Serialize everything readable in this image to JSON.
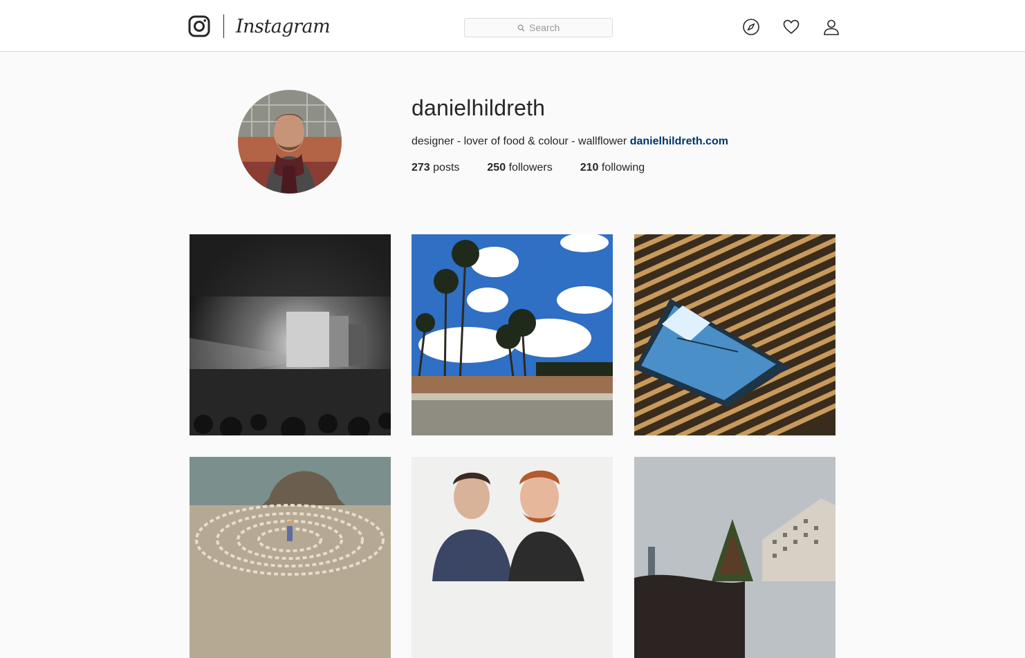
{
  "header": {
    "wordmark": "Instagram",
    "search_placeholder": "Search",
    "icons": [
      "instagram-camera-icon",
      "search-icon",
      "explore-compass-icon",
      "activity-heart-icon",
      "profile-person-icon"
    ]
  },
  "profile": {
    "username": "danielhildreth",
    "bio_text": "designer - lover of food & colour - wallflower",
    "bio_link": "danielhildreth.com",
    "stats": {
      "posts_count": "273",
      "posts_label": "posts",
      "followers_count": "250",
      "followers_label": "followers",
      "following_count": "210",
      "following_label": "following"
    }
  },
  "colors": {
    "link": "#003569",
    "border": "#dbdbdb",
    "background": "#fafafa"
  },
  "posts": [
    "concert-stage-bw",
    "palm-trees-sky",
    "wood-slat-ceiling-skylight",
    "rock-labyrinth-coast",
    "two-men-portrait",
    "christmas-tree-building"
  ]
}
